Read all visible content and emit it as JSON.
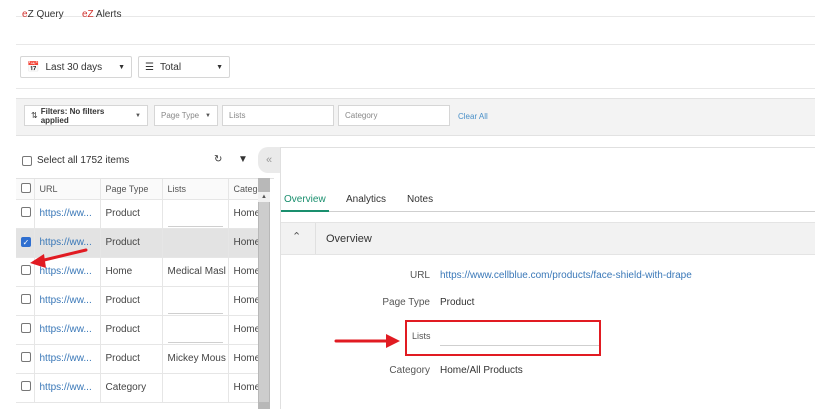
{
  "topnav": {
    "items": [
      {
        "brand": "e",
        "rest": "Z Query"
      },
      {
        "brand": "eZ",
        "rest": " Alerts"
      }
    ]
  },
  "controls": {
    "date_range": "Last 30 days",
    "aggregate": "Total"
  },
  "filters": {
    "filters_button": "Filters: No filters applied",
    "page_type_placeholder": "Page Type",
    "lists_placeholder": "Lists",
    "category_placeholder": "Category",
    "clear_all": "Clear All"
  },
  "list": {
    "select_all": "Select all 1752 items",
    "columns": [
      "URL",
      "Page Type",
      "Lists",
      "Category"
    ],
    "rows": [
      {
        "url": "https://ww...",
        "page_type": "Product",
        "lists": "",
        "category": "Home",
        "checked": false
      },
      {
        "url": "https://ww...",
        "page_type": "Product",
        "lists": "",
        "category": "Home",
        "checked": true
      },
      {
        "url": "https://ww...",
        "page_type": "Home",
        "lists": "Medical Masl",
        "category": "Home",
        "checked": false
      },
      {
        "url": "https://ww...",
        "page_type": "Product",
        "lists": "",
        "category": "Home",
        "checked": false
      },
      {
        "url": "https://ww...",
        "page_type": "Product",
        "lists": "",
        "category": "Home",
        "checked": false
      },
      {
        "url": "https://ww...",
        "page_type": "Product",
        "lists": "Mickey Mous",
        "category": "Home",
        "checked": false
      },
      {
        "url": "https://ww...",
        "page_type": "Category",
        "lists": "",
        "category": "Home",
        "checked": false
      }
    ]
  },
  "detail": {
    "tabs": [
      "Overview",
      "Analytics",
      "Notes"
    ],
    "active_tab": "Overview",
    "section_title": "Overview",
    "fields": {
      "url_label": "URL",
      "url_value": "https://www.cellblue.com/products/face-shield-with-drape",
      "page_type_label": "Page Type",
      "page_type_value": "Product",
      "lists_label": "Lists",
      "lists_value": "",
      "category_label": "Category",
      "category_value": "Home/All Products"
    }
  },
  "colors": {
    "brand": "#d0312d",
    "link": "#3a78b8",
    "active_tab": "#1a8f6e",
    "annotation": "#e11b22",
    "checkbox": "#2f6fd0"
  },
  "icons": [
    "calendar-icon",
    "list-icon",
    "filter-sort-icon",
    "refresh-icon",
    "filter-icon",
    "collapse-left-icon",
    "chevron-up-icon"
  ]
}
